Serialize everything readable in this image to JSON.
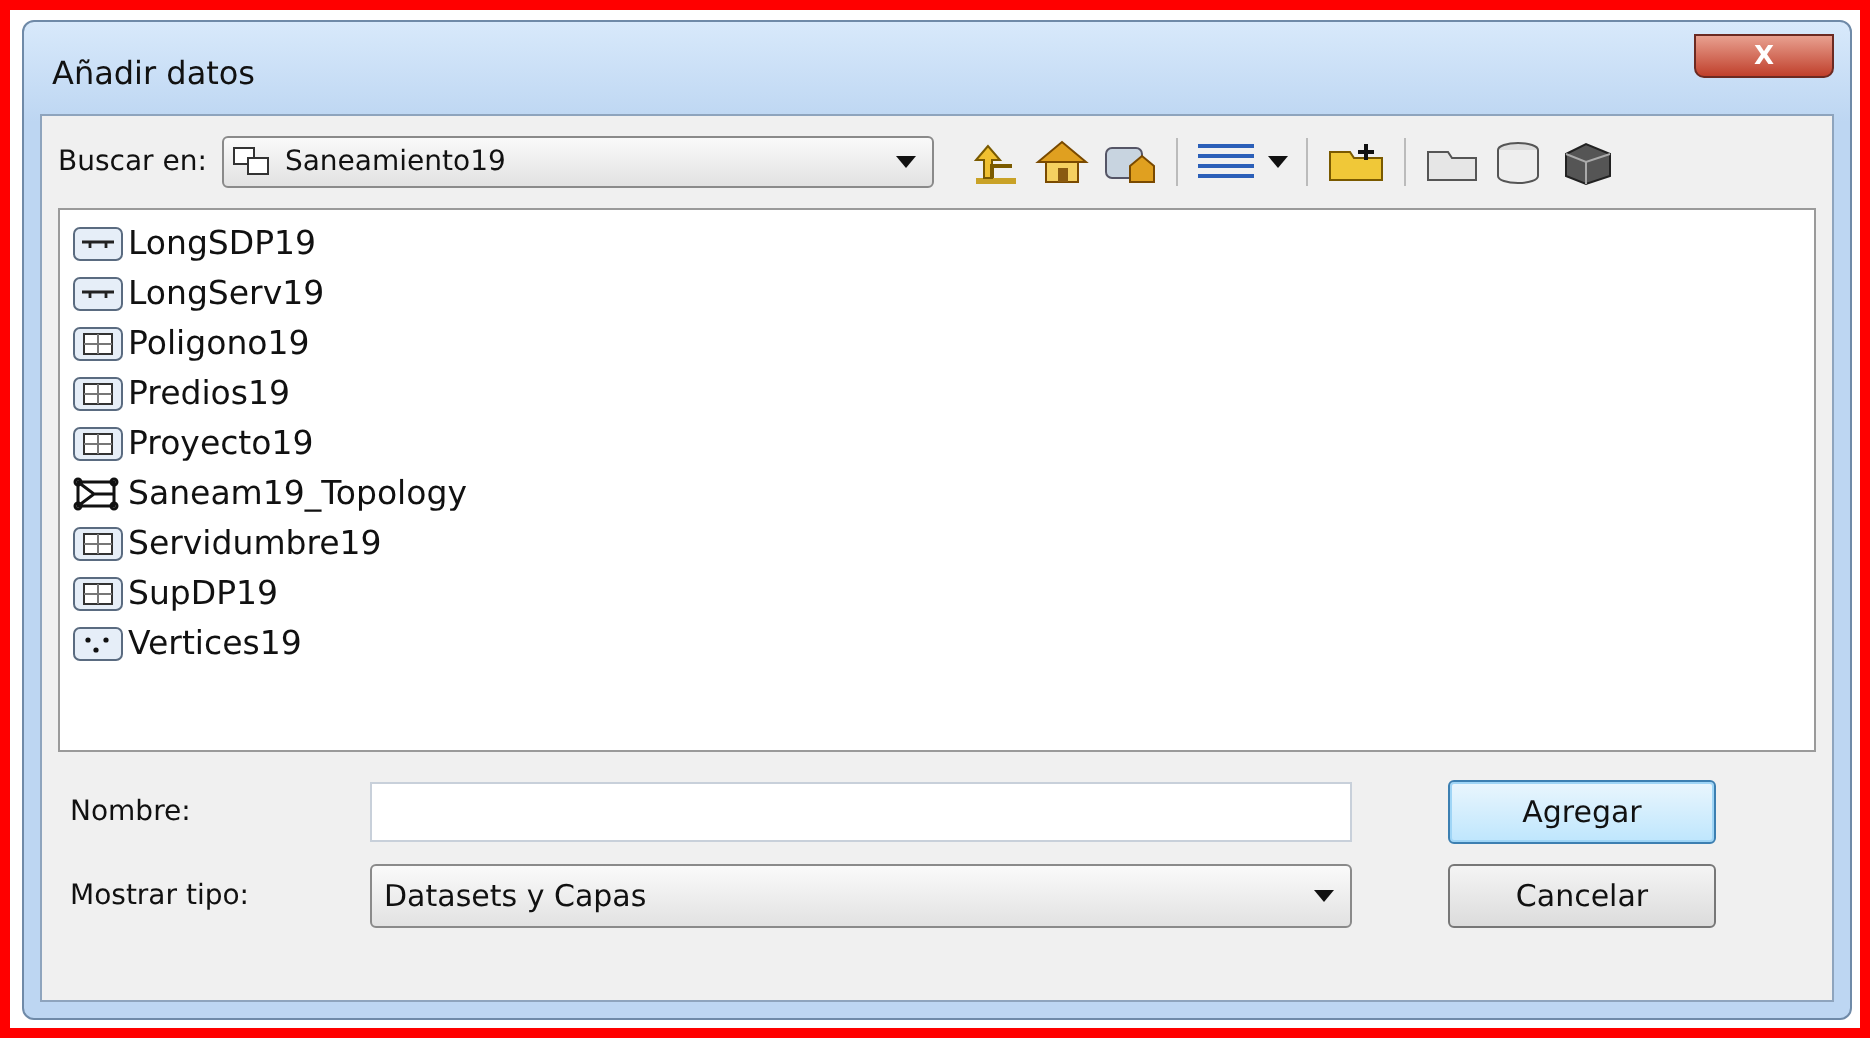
{
  "window": {
    "title": "Añadir datos",
    "close": "X"
  },
  "toolbar": {
    "label": "Buscar en:",
    "location": "Saneamiento19"
  },
  "items": [
    {
      "name": "LongSDP19",
      "kind": "line"
    },
    {
      "name": "LongServ19",
      "kind": "line"
    },
    {
      "name": "Poligono19",
      "kind": "polygon"
    },
    {
      "name": "Predios19",
      "kind": "polygon"
    },
    {
      "name": "Proyecto19",
      "kind": "polygon"
    },
    {
      "name": "Saneam19_Topology",
      "kind": "topology"
    },
    {
      "name": "Servidumbre19",
      "kind": "polygon"
    },
    {
      "name": "SupDP19",
      "kind": "polygon"
    },
    {
      "name": "Vertices19",
      "kind": "point"
    }
  ],
  "name_field": {
    "label": "Nombre:"
  },
  "type_field": {
    "label": "Mostrar tipo:",
    "value": "Datasets y Capas"
  },
  "buttons": [
    "Agregar",
    "Cancelar"
  ]
}
